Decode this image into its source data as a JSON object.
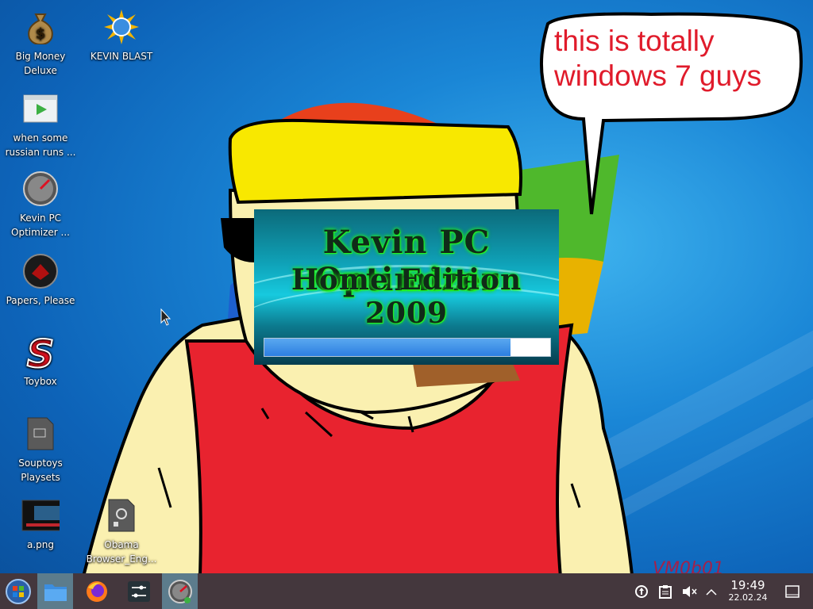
{
  "desktop": {
    "icons": [
      {
        "label": "Big Money\nDeluxe",
        "icon": "money-bag-icon"
      },
      {
        "label": "KEVIN BLAST",
        "icon": "blast-sun-icon"
      },
      {
        "label": "when some\nrussian runs ...",
        "icon": "video-file-icon"
      },
      {
        "label": "Kevin PC\nOptimizer ...",
        "icon": "speedometer-icon"
      },
      {
        "label": "Papers, Please",
        "icon": "papers-please-icon"
      },
      {
        "label": "Toybox",
        "icon": "toybox-s-icon"
      },
      {
        "label": "Souptoys\nPlaysets",
        "icon": "document-icon"
      },
      {
        "label": "a.png",
        "icon": "image-thumbnail-icon"
      },
      {
        "label": "Obama\nBrowser_Eng...",
        "icon": "settings-file-icon"
      }
    ]
  },
  "meme": {
    "bubble_line1": "this is totally",
    "bubble_line2": "windows 7 guys"
  },
  "splash": {
    "title_line1": "Kevin PC Optimizer",
    "title_line2": "Home Edition 2009",
    "progress": 0.86
  },
  "taskbar": {
    "start": "start-orb-icon",
    "apps": [
      "file-manager-icon",
      "firefox-icon",
      "mixer-settings-icon",
      "speedometer-icon"
    ],
    "tray": [
      "update-icon",
      "clipboard-icon",
      "volume-muted-icon",
      "chevron-up-icon"
    ],
    "time": "19:49",
    "date": "22.02.24",
    "show_desktop": "show-desktop-icon"
  },
  "watermark": "VM0b01",
  "colors": {
    "bubble_text": "#e01b2b",
    "taskbar": "#44373d",
    "progress": "#2c7ee0"
  }
}
